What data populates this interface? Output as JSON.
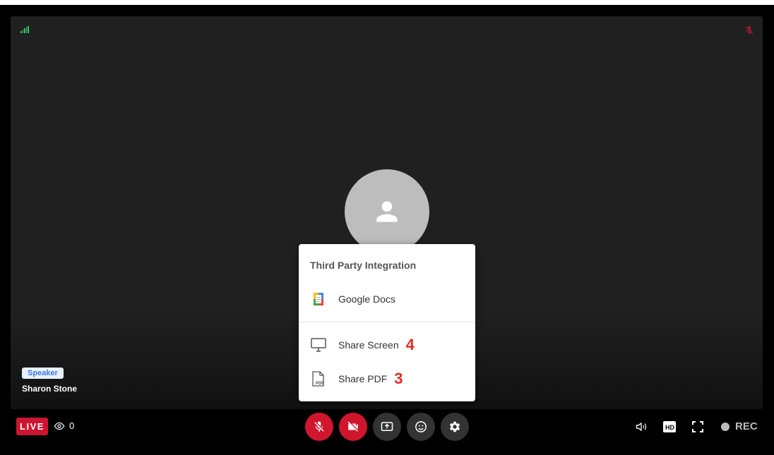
{
  "participant": {
    "role_badge": "Speaker",
    "name": "Sharon Stone"
  },
  "menu": {
    "title": "Third Party Integration",
    "items": [
      {
        "label": "Google Docs",
        "icon": "google-docs-icon",
        "number": ""
      },
      {
        "label": "Share Screen",
        "icon": "monitor-icon",
        "number": "4"
      },
      {
        "label": "Share PDF",
        "icon": "pdf-file-icon",
        "number": "3"
      }
    ]
  },
  "status": {
    "live_label": "LIVE",
    "viewer_count": "0",
    "rec_label": "REC"
  },
  "controls": [
    {
      "name": "mic-off",
      "icon": "mic-off-icon",
      "state": "muted",
      "color": "#d0162d"
    },
    {
      "name": "camera-off",
      "icon": "video-off-icon",
      "state": "off",
      "color": "#d0162d"
    },
    {
      "name": "share",
      "icon": "screen-share-icon",
      "color": "#333333"
    },
    {
      "name": "reactions",
      "icon": "emoji-icon",
      "color": "#333333"
    },
    {
      "name": "settings",
      "icon": "gear-icon",
      "color": "#333333"
    }
  ],
  "right_controls": [
    "volume-icon",
    "hd-icon",
    "fullscreen-icon"
  ],
  "colors": {
    "live": "#cc1530",
    "muted_control": "#d0162d",
    "signal": "#35c76a",
    "annotation": "#e52b2b",
    "badge_text": "#3b78e7"
  }
}
